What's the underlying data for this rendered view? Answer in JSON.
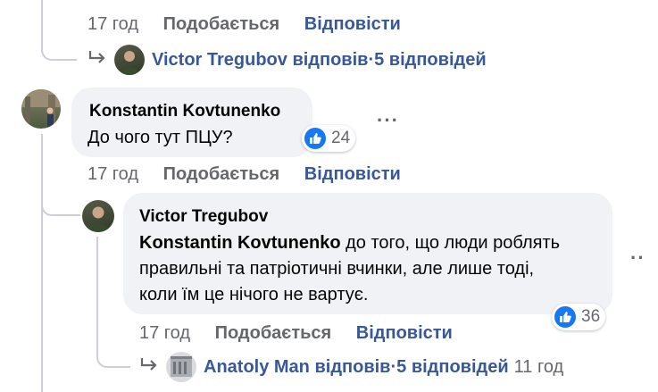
{
  "comment0": {
    "meta": {
      "time": "17 год",
      "like": "Подобається",
      "reply": "Відповісти"
    },
    "replies": {
      "name": "Victor Tregubov",
      "verb": "відповів",
      "sep": " · ",
      "count": "5 відповідей"
    }
  },
  "comment1": {
    "author": "Konstantin Kovtunenko",
    "text": "До чого тут ПЦУ?",
    "reactions": "24",
    "meta": {
      "time": "17 год",
      "like": "Подобається",
      "reply": "Відповісти"
    }
  },
  "reply1": {
    "author": "Victor Tregubov",
    "mention": "Konstantin Kovtunenko",
    "line1": " до того, що люди роблять",
    "line2": "правильні та патріотичні вчинки, але лише тоді,",
    "line3": "коли їм це нічого не вартує.",
    "reactions": "36",
    "meta": {
      "time": "17 год",
      "like": "Подобається",
      "reply": "Відповісти"
    },
    "replies": {
      "name": "Anatoly Man",
      "verb": "відповів",
      "sep": " · ",
      "count": "5 відповідей",
      "time": "11 год"
    }
  },
  "colors": {
    "bubble": "#f0f2f5",
    "link": "#385898",
    "meta": "#65676b",
    "like": "#1877f2"
  },
  "icons": [
    "reply-arrow-icon",
    "like-icon",
    "more-options-icon"
  ]
}
